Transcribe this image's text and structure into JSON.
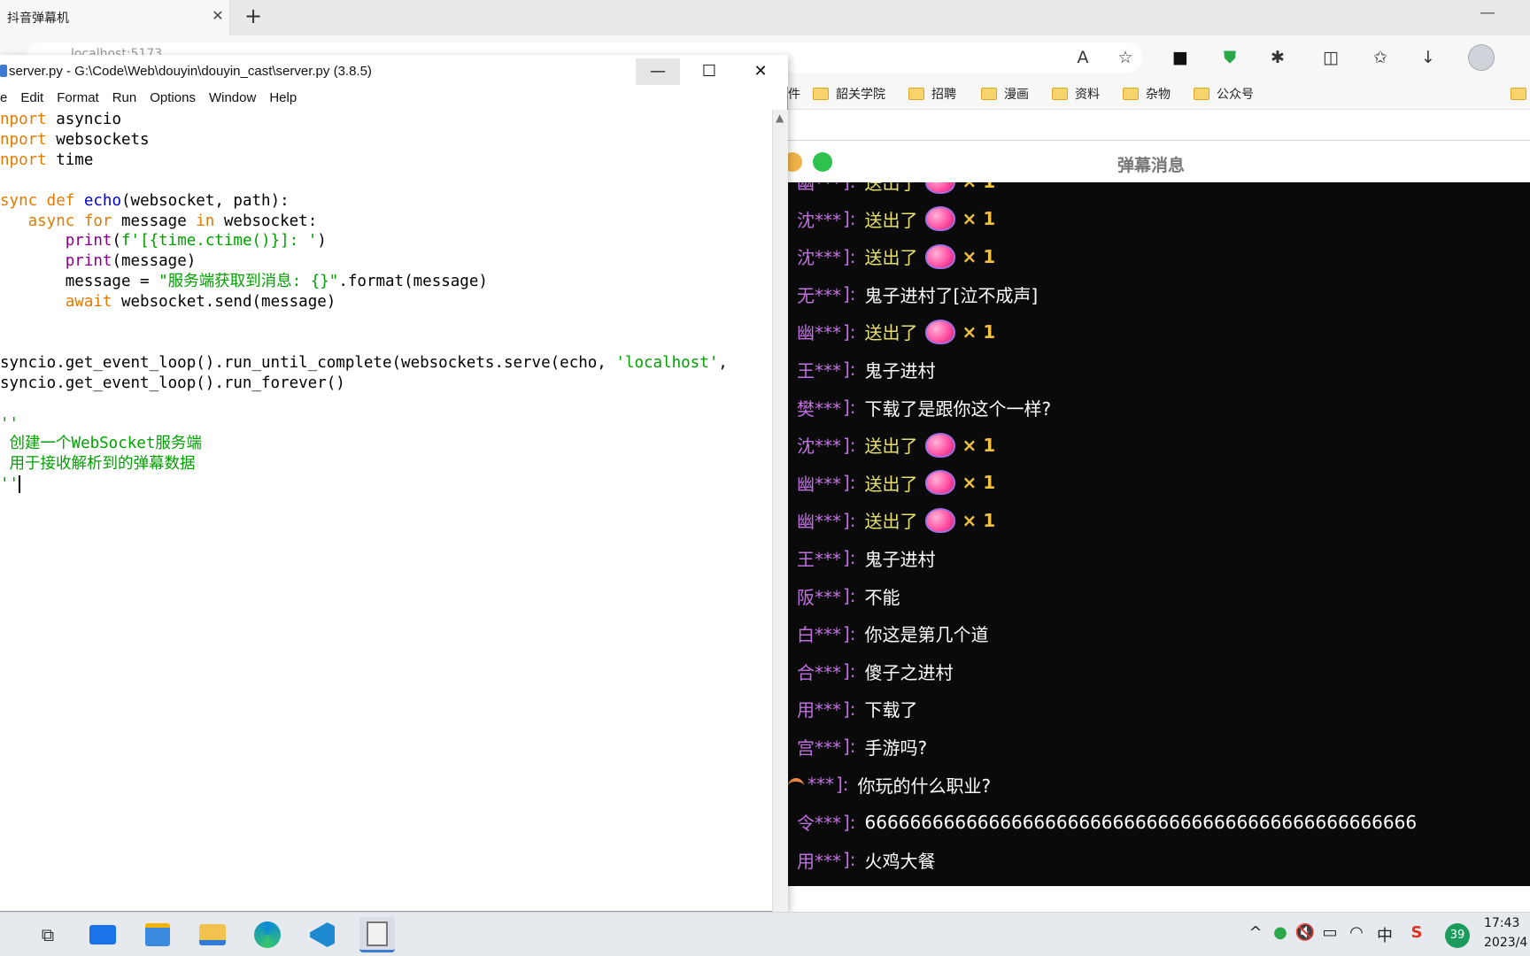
{
  "browser": {
    "tab_title": "抖音弹幕机",
    "tab_close": "✕",
    "new_tab": "+",
    "window_minimize": "—",
    "address_text": "localhost:5173",
    "bookmarks": [
      "韶关学院",
      "招聘",
      "漫画",
      "资料",
      "杂物",
      "公众号"
    ],
    "bookmark_partial": "件"
  },
  "idle": {
    "title": "server.py - G:\\Code\\Web\\douyin\\douyin_cast\\server.py (3.8.5)",
    "menu": [
      "e",
      "Edit",
      "Format",
      "Run",
      "Options",
      "Window",
      "Help"
    ],
    "btn_min": "—",
    "btn_max": "☐",
    "btn_close": "✕"
  },
  "code_lines": [
    [
      {
        "t": "nport",
        "c": "kw"
      },
      {
        "t": " asyncio"
      }
    ],
    [
      {
        "t": "nport",
        "c": "kw"
      },
      {
        "t": " websockets"
      }
    ],
    [
      {
        "t": "nport",
        "c": "kw"
      },
      {
        "t": " time"
      }
    ],
    [
      {
        "t": ""
      }
    ],
    [
      {
        "t": "sync def",
        "c": "kw"
      },
      {
        "t": " "
      },
      {
        "t": "echo",
        "c": "fn"
      },
      {
        "t": "(websocket, path):"
      }
    ],
    [
      {
        "t": "   "
      },
      {
        "t": "async for",
        "c": "kw"
      },
      {
        "t": " message "
      },
      {
        "t": "in",
        "c": "kw"
      },
      {
        "t": " websocket:"
      }
    ],
    [
      {
        "t": "       "
      },
      {
        "t": "print",
        "c": "bi"
      },
      {
        "t": "("
      },
      {
        "t": "f'[{time.ctime()}]: '",
        "c": "str"
      },
      {
        "t": ")"
      }
    ],
    [
      {
        "t": "       "
      },
      {
        "t": "print",
        "c": "bi"
      },
      {
        "t": "(message)"
      }
    ],
    [
      {
        "t": "       message = "
      },
      {
        "t": "\"服务端获取到消息: {}\"",
        "c": "str"
      },
      {
        "t": ".format(message)"
      }
    ],
    [
      {
        "t": "       "
      },
      {
        "t": "await",
        "c": "kw"
      },
      {
        "t": " websocket.send(message)"
      }
    ],
    [
      {
        "t": ""
      }
    ],
    [
      {
        "t": ""
      }
    ],
    [
      {
        "t": "syncio.get_event_loop().run_until_complete(websockets.serve(echo, "
      },
      {
        "t": "'localhost'",
        "c": "str"
      },
      {
        "t": ","
      }
    ],
    [
      {
        "t": "syncio.get_event_loop().run_forever()"
      }
    ],
    [
      {
        "t": ""
      }
    ],
    [
      {
        "t": "''",
        "c": "str"
      }
    ],
    [
      {
        "t": " 创建一个WebSocket服务端",
        "c": "str"
      }
    ],
    [
      {
        "t": " 用于接收解析到的弹幕数据",
        "c": "str"
      }
    ],
    [
      {
        "t": "''",
        "c": "str"
      }
    ]
  ],
  "danmaku": {
    "title": "弹幕消息",
    "gift_text": "送出了",
    "gift_count": "× 1",
    "rows": [
      {
        "user": "沈***",
        "kind": "gift"
      },
      {
        "user": "沈***",
        "kind": "gift"
      },
      {
        "user": "无***",
        "kind": "msg",
        "text": "鬼子进村了[泣不成声]"
      },
      {
        "user": "幽***",
        "kind": "gift"
      },
      {
        "user": "王***",
        "kind": "msg",
        "text": "鬼子进村"
      },
      {
        "user": "樊***",
        "kind": "msg",
        "text": "下载了是跟你这个一样?"
      },
      {
        "user": "沈***",
        "kind": "gift"
      },
      {
        "user": "幽***",
        "kind": "gift"
      },
      {
        "user": "幽***",
        "kind": "gift"
      },
      {
        "user": "王***",
        "kind": "msg",
        "text": "鬼子进村"
      },
      {
        "user": "阪***",
        "kind": "msg",
        "text": "不能"
      },
      {
        "user": "白***",
        "kind": "msg",
        "text": "你这是第几个道"
      },
      {
        "user": "合***",
        "kind": "msg",
        "text": "傻子之进村"
      },
      {
        "user": "用***",
        "kind": "msg",
        "text": "下载了"
      },
      {
        "user": "宫***",
        "kind": "msg",
        "text": "手游吗?"
      },
      {
        "user": "***",
        "kind": "msg",
        "text": "你玩的什么职业?",
        "rainbow": true
      },
      {
        "user": "令***",
        "kind": "msg",
        "text": "6666666666666666666666666666666666666666666666666"
      },
      {
        "user": "用***",
        "kind": "msg",
        "text": "火鸡大餐"
      }
    ]
  },
  "taskbar": {
    "tray_caret": "^",
    "ime": "中",
    "weather_badge": "39",
    "clock_time": "17:43",
    "clock_date": "2023/4"
  },
  "colors": {
    "username": "#c070e0",
    "gift": "#e8e070",
    "count": "#f0c040",
    "keyword": "#e07b00",
    "string": "#00a000",
    "builtin": "#8b008b",
    "funcname": "#0000c8"
  }
}
